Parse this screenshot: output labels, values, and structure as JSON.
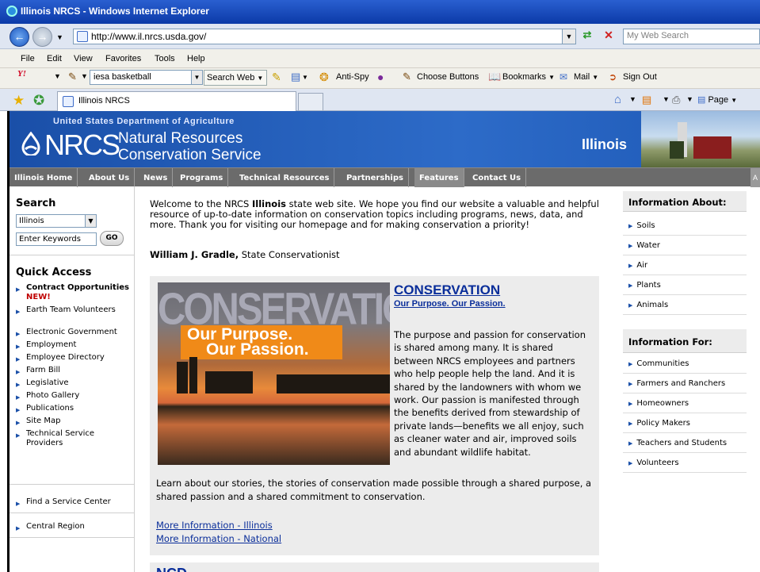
{
  "browser": {
    "title": "Illinois NRCS - Windows Internet Explorer",
    "url": "http://www.il.nrcs.usda.gov/",
    "search_placeholder": "My Web Search",
    "menu": [
      "File",
      "Edit",
      "View",
      "Favorites",
      "Tools",
      "Help"
    ],
    "tab_title": "Illinois NRCS",
    "page_menu": "Page"
  },
  "yahoo_toolbar": {
    "logo": "Y!",
    "search_value": "iesa basketball",
    "search_button": "Search Web",
    "items": [
      "Anti-Spy",
      "Choose Buttons",
      "Bookmarks",
      "Mail",
      "Sign Out"
    ]
  },
  "banner": {
    "usda": "United States Department of Agriculture",
    "nrcs": "NRCS",
    "line1": "Natural Resources",
    "line2": "Conservation Service",
    "state": "Illinois"
  },
  "nav": [
    {
      "label": "Illinois Home"
    },
    {
      "label": "About Us"
    },
    {
      "label": "News"
    },
    {
      "label": "Programs"
    },
    {
      "label": "Technical Resources"
    },
    {
      "label": "Partnerships"
    },
    {
      "label": "Features"
    },
    {
      "label": "Contact Us"
    }
  ],
  "nav_overflow": "A",
  "left": {
    "search_title": "Search",
    "state_selected": "Illinois",
    "keywords_placeholder": "Enter Keywords",
    "go": "GO",
    "quick_access_title": "Quick Access",
    "quick_links": [
      {
        "label": "Contract Opportunities",
        "badge": "NEW!"
      },
      {
        "label": "Earth Team Volunteers"
      },
      {
        "label": "Electronic Government"
      },
      {
        "label": "Employment"
      },
      {
        "label": "Employee Directory"
      },
      {
        "label": "Farm Bill"
      },
      {
        "label": "Legislative"
      },
      {
        "label": "Photo Gallery"
      },
      {
        "label": "Publications"
      },
      {
        "label": "Site Map"
      },
      {
        "label": "Technical Service Providers"
      }
    ],
    "service_center": "Find a Service Center",
    "central_region": "Central Region"
  },
  "main": {
    "welcome_pre": "Welcome to the NRCS ",
    "welcome_bold": "Illinois",
    "welcome_post": " state web site.  We hope you find our website a valuable and helpful resource of up-to-date information on conservation topics including programs, news, data, and more. Thank you for visiting our homepage and for making conservation a priority!",
    "signer_name": "William J. Gradle,",
    "signer_title": " State Conservationist",
    "feature": {
      "image_word": "CONSERVATION",
      "image_tag_1": "Our Purpose.",
      "image_tag_2": "Our Passion.",
      "title": "CONSERVATION",
      "subtitle": "Our Purpose. Our Passion.",
      "body": "The purpose and passion for conservation is shared among many. It is shared between NRCS employees and partners who help people help the land. And it is shared by the landowners with whom we work. Our passion is manifested through the benefits derived from stewardship of private lands—benefits we all enjoy, such as cleaner water and air, improved soils and abundant wildlife habitat.",
      "learn": "Learn about our stories, the stories of conservation made possible through a shared purpose, a shared passion and a shared commitment to conservation.",
      "link_illinois": "More Information - Illinois",
      "link_national": "More Information - National"
    },
    "next_feature_peek": "NCD"
  },
  "right": {
    "about_title": "Information About:",
    "about_items": [
      "Soils",
      "Water",
      "Air",
      "Plants",
      "Animals"
    ],
    "for_title": "Information For:",
    "for_items": [
      "Communities",
      "Farmers and Ranchers",
      "Homeowners",
      "Policy Makers",
      "Teachers and Students",
      "Volunteers"
    ]
  }
}
